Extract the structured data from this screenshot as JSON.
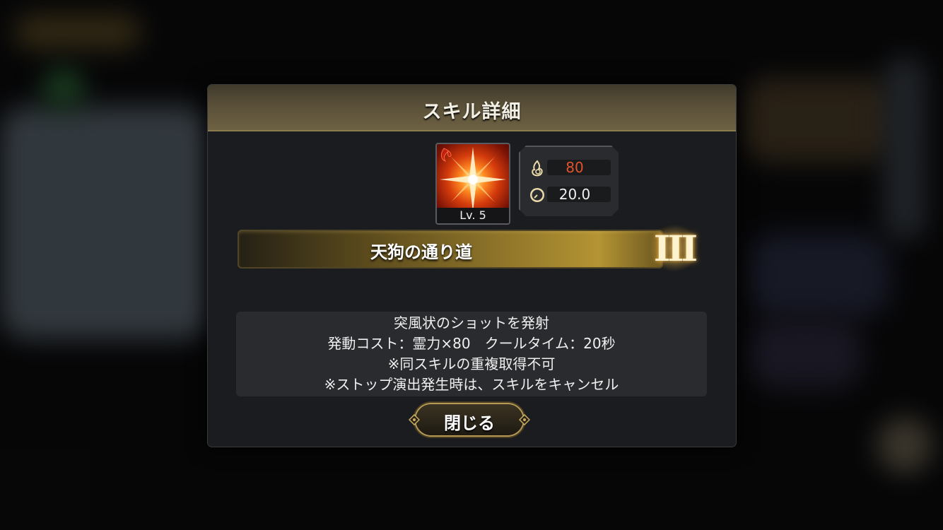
{
  "modal": {
    "title": "スキル詳細",
    "skill": {
      "icon": "burst-star-icon",
      "level_label": "Lv. 5",
      "cost_icon": "spirit-flame-icon",
      "cost_value": "80",
      "cooldown_icon": "clock-icon",
      "cooldown_value": "20.0",
      "name": "天狗の通り道",
      "rank_numeral": "III"
    },
    "description_lines": [
      "突風状のショットを発射",
      "発動コスト：霊力×80　クールタイム：20秒",
      "※同スキルの重複取得不可",
      "※ストップ演出発生時は、スキルをキャンセル"
    ],
    "close_label": "閉じる"
  },
  "colors": {
    "cost_value": "#e0532c",
    "cooldown_value": "#f0f0f0",
    "header_gold": "#6d6142",
    "accent_gold": "#b49433"
  }
}
